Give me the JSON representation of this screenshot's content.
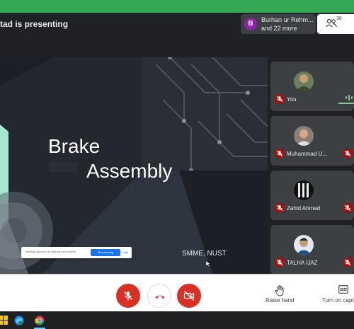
{
  "top_bar": {
    "presenting_text": "tad is presenting",
    "participants_chip": {
      "avatar_initial": "B",
      "line1": "Burhan ur Rehm...",
      "line2": "and 22 more"
    },
    "people_count": "36"
  },
  "slide": {
    "title_line1": "Brake",
    "title_line2": "Assembly",
    "footer": "SMME, NUST",
    "share_notice": {
      "text": "meet.google.com is sharing your screen.",
      "stop_label": "Stop sharing",
      "hide_label": "Hide"
    }
  },
  "participants": [
    {
      "name": "You",
      "speaking": true
    },
    {
      "name": "Muhammad U...",
      "speaking": false
    },
    {
      "name": "Zahid Ahmad",
      "speaking": false
    },
    {
      "name": "TALHA IJAZ",
      "speaking": false
    }
  ],
  "controls": {
    "raise_hand_label": "Raise hand",
    "captions_label": "Turn on capt"
  },
  "colors": {
    "accent_green": "#34a853",
    "danger_red": "#d93025",
    "muted_red": "#a50e0e",
    "mint": "#a8e6cf",
    "speaking_green": "#81c995"
  },
  "icons": [
    "people-icon",
    "mic-off-icon",
    "end-call-icon",
    "camera-off-icon",
    "raise-hand-icon",
    "captions-icon",
    "speaking-indicator-icon",
    "windows-start-icon",
    "edge-icon",
    "chrome-icon"
  ]
}
